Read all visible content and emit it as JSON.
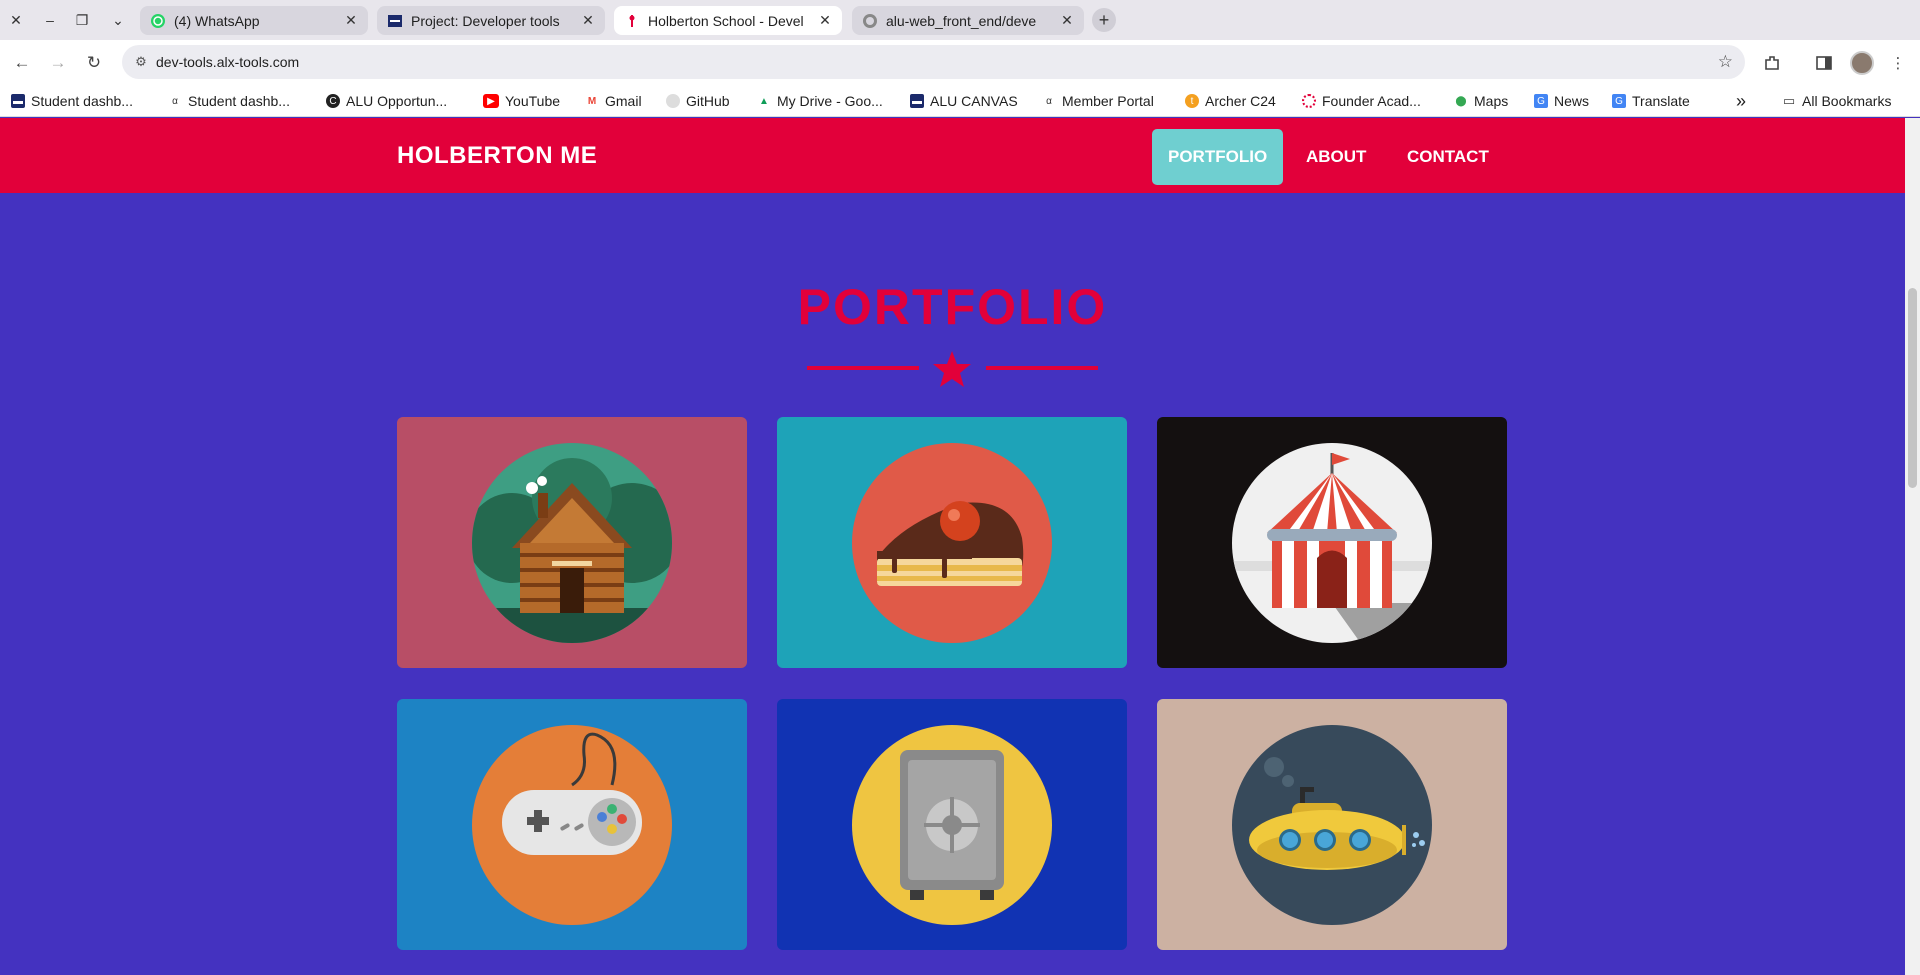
{
  "browser": {
    "tabs": [
      {
        "title": "(4) WhatsApp"
      },
      {
        "title": "Project: Developer tools"
      },
      {
        "title": "Holberton School - Devel"
      },
      {
        "title": "alu-web_front_end/deve"
      }
    ],
    "url": "dev-tools.alx-tools.com",
    "bookmarks": [
      {
        "label": "Student dashb...",
        "icon": "alu-icon"
      },
      {
        "label": "Student dashb...",
        "icon": "alx-icon"
      },
      {
        "label": "ALU Opportun...",
        "icon": "c-icon"
      },
      {
        "label": "YouTube",
        "icon": "youtube-icon"
      },
      {
        "label": "Gmail",
        "icon": "gmail-icon"
      },
      {
        "label": "GitHub",
        "icon": "github-icon"
      },
      {
        "label": "My Drive - Goo...",
        "icon": "drive-icon"
      },
      {
        "label": "ALU CANVAS",
        "icon": "alu-icon"
      },
      {
        "label": "Member Portal",
        "icon": "alx-icon"
      },
      {
        "label": "Archer C24",
        "icon": "tplink-icon"
      },
      {
        "label": "Founder Acad...",
        "icon": "founder-icon"
      },
      {
        "label": "Maps",
        "icon": "maps-icon"
      },
      {
        "label": "News",
        "icon": "news-icon"
      },
      {
        "label": "Translate",
        "icon": "translate-icon"
      }
    ],
    "all_bookmarks": "All Bookmarks",
    "overflow": "»"
  },
  "site": {
    "brand": "HOLBERTON ME",
    "nav": [
      {
        "label": "PORTFOLIO",
        "active": true
      },
      {
        "label": "ABOUT",
        "active": false
      },
      {
        "label": "CONTACT",
        "active": false
      }
    ],
    "section_title": "PORTFOLIO",
    "portfolio": [
      {
        "art": "cabin-icon",
        "bg": "#b84e66",
        "circle": "#3e9e83"
      },
      {
        "art": "cake-icon",
        "bg": "#1ea3b8",
        "circle": "#e05a48"
      },
      {
        "art": "circus-tent-icon",
        "bg": "#141010",
        "circle": "#f0f0f0"
      },
      {
        "art": "game-controller-icon",
        "bg": "#1d83c4",
        "circle": "#e47e38"
      },
      {
        "art": "safe-icon",
        "bg": "#1133b3",
        "circle": "#efc541"
      },
      {
        "art": "submarine-icon",
        "bg": "#ccb1a2",
        "circle": "#374a5b"
      }
    ]
  },
  "colors": {
    "header": "#e2003a",
    "page_bg": "#4432c0",
    "nav_active": "#6fcfd0",
    "accent": "#e2003a"
  }
}
